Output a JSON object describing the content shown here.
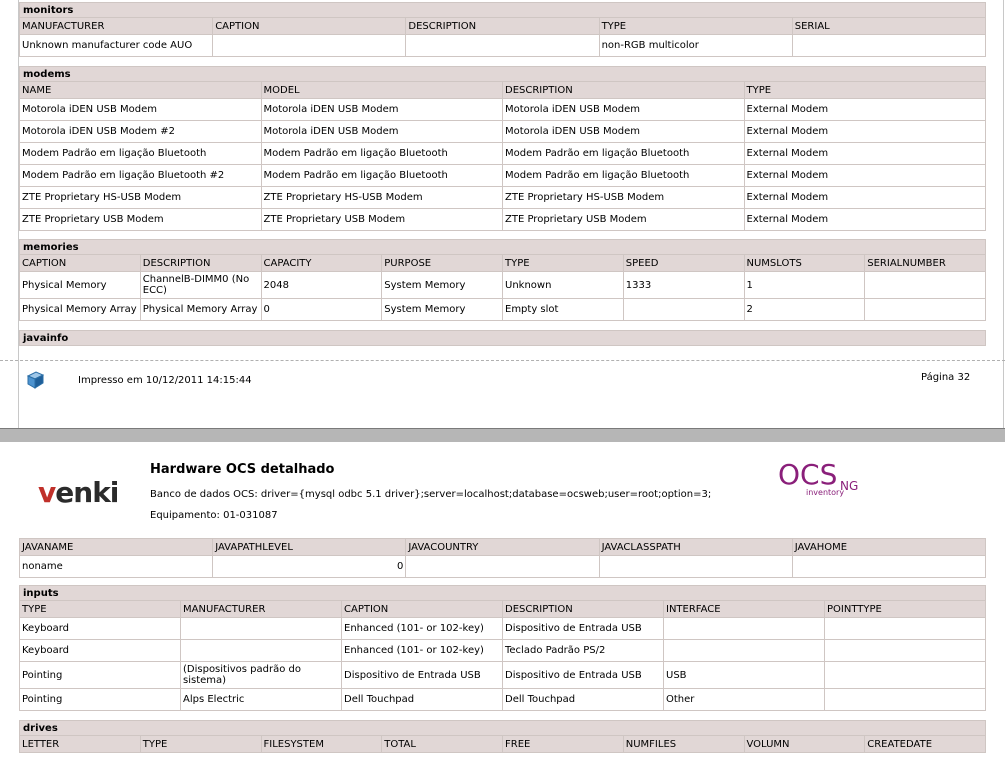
{
  "monitors": {
    "title": "monitors",
    "headers": [
      "MANUFACTURER",
      "CAPTION",
      "DESCRIPTION",
      "TYPE",
      "SERIAL"
    ],
    "rows": [
      [
        "Unknown manufacturer code AUO",
        "",
        "",
        "non-RGB multicolor",
        ""
      ]
    ]
  },
  "modems": {
    "title": "modems",
    "headers": [
      "NAME",
      "MODEL",
      "DESCRIPTION",
      "TYPE"
    ],
    "rows": [
      [
        "Motorola iDEN USB Modem",
        "Motorola iDEN USB Modem",
        "Motorola iDEN USB Modem",
        "External Modem"
      ],
      [
        "Motorola iDEN USB Modem #2",
        "Motorola iDEN USB Modem",
        "Motorola iDEN USB Modem",
        "External Modem"
      ],
      [
        "Modem Padrão em ligação Bluetooth",
        "Modem Padrão em ligação Bluetooth",
        "Modem Padrão em ligação Bluetooth",
        "External Modem"
      ],
      [
        "Modem Padrão em ligação Bluetooth #2",
        "Modem Padrão em ligação Bluetooth",
        "Modem Padrão em ligação Bluetooth",
        "External Modem"
      ],
      [
        "ZTE Proprietary HS-USB Modem",
        "ZTE Proprietary HS-USB Modem",
        "ZTE Proprietary HS-USB Modem",
        "External Modem"
      ],
      [
        "ZTE Proprietary USB Modem",
        "ZTE Proprietary USB Modem",
        "ZTE Proprietary USB Modem",
        "External Modem"
      ]
    ]
  },
  "memories": {
    "title": "memories",
    "headers": [
      "CAPTION",
      "DESCRIPTION",
      "CAPACITY",
      "PURPOSE",
      "TYPE",
      "SPEED",
      "NUMSLOTS",
      "SERIALNUMBER"
    ],
    "rows": [
      [
        "Physical Memory",
        "ChannelB-DIMM0 (No ECC)",
        "2048",
        "System Memory",
        "Unknown",
        "1333",
        "1",
        ""
      ],
      [
        "Physical Memory Array",
        "Physical Memory Array",
        "0",
        "System Memory",
        "Empty slot",
        "",
        "2",
        ""
      ]
    ]
  },
  "javainfo_section": {
    "title": "javainfo"
  },
  "footer": {
    "printed": "Impresso em 10/12/2011 14:15:44",
    "page": "Página 32",
    "icon": "cube-icon"
  },
  "header": {
    "brand": "venki",
    "brand_v": "v",
    "brand_rest": "enki",
    "title": "Hardware OCS detalhado",
    "database": "Banco de dados OCS: driver={mysql odbc 5.1 driver};server=localhost;database=ocsweb;user=root;option=3;",
    "equipment": "Equipamento: 01-031087",
    "ocs_logo_text": "OCS",
    "ocs_logo_sub": "inventory",
    "ocs_logo_ng": "NG"
  },
  "javainfo": {
    "headers": [
      "JAVANAME",
      "JAVAPATHLEVEL",
      "JAVACOUNTRY",
      "JAVACLASSPATH",
      "JAVAHOME"
    ],
    "rows": [
      [
        "noname",
        "0",
        "",
        "",
        ""
      ]
    ]
  },
  "inputs": {
    "title": "inputs",
    "headers": [
      "TYPE",
      "MANUFACTURER",
      "CAPTION",
      "DESCRIPTION",
      "INTERFACE",
      "POINTTYPE"
    ],
    "rows": [
      [
        "Keyboard",
        "",
        "Enhanced (101- or 102-key)",
        "Dispositivo de Entrada USB",
        "",
        ""
      ],
      [
        "Keyboard",
        "",
        "Enhanced (101- or 102-key)",
        "Teclado Padrão PS/2",
        "",
        ""
      ],
      [
        "Pointing",
        "(Dispositivos padrão do sistema)",
        "Dispositivo de Entrada USB",
        "Dispositivo de Entrada USB",
        "USB",
        ""
      ],
      [
        "Pointing",
        "Alps Electric",
        "Dell Touchpad",
        "Dell Touchpad",
        "Other",
        ""
      ]
    ]
  },
  "drives": {
    "title": "drives",
    "headers": [
      "LETTER",
      "TYPE",
      "FILESYSTEM",
      "TOTAL",
      "FREE",
      "NUMFILES",
      "VOLUMN",
      "CREATEDATE"
    ]
  },
  "colors": {
    "header_bg": "#e1d7d6",
    "border": "#cfc6c3",
    "separator": "#b6b6b6",
    "ocs_purple": "#8a1f7a",
    "venki_red": "#c0302a"
  }
}
